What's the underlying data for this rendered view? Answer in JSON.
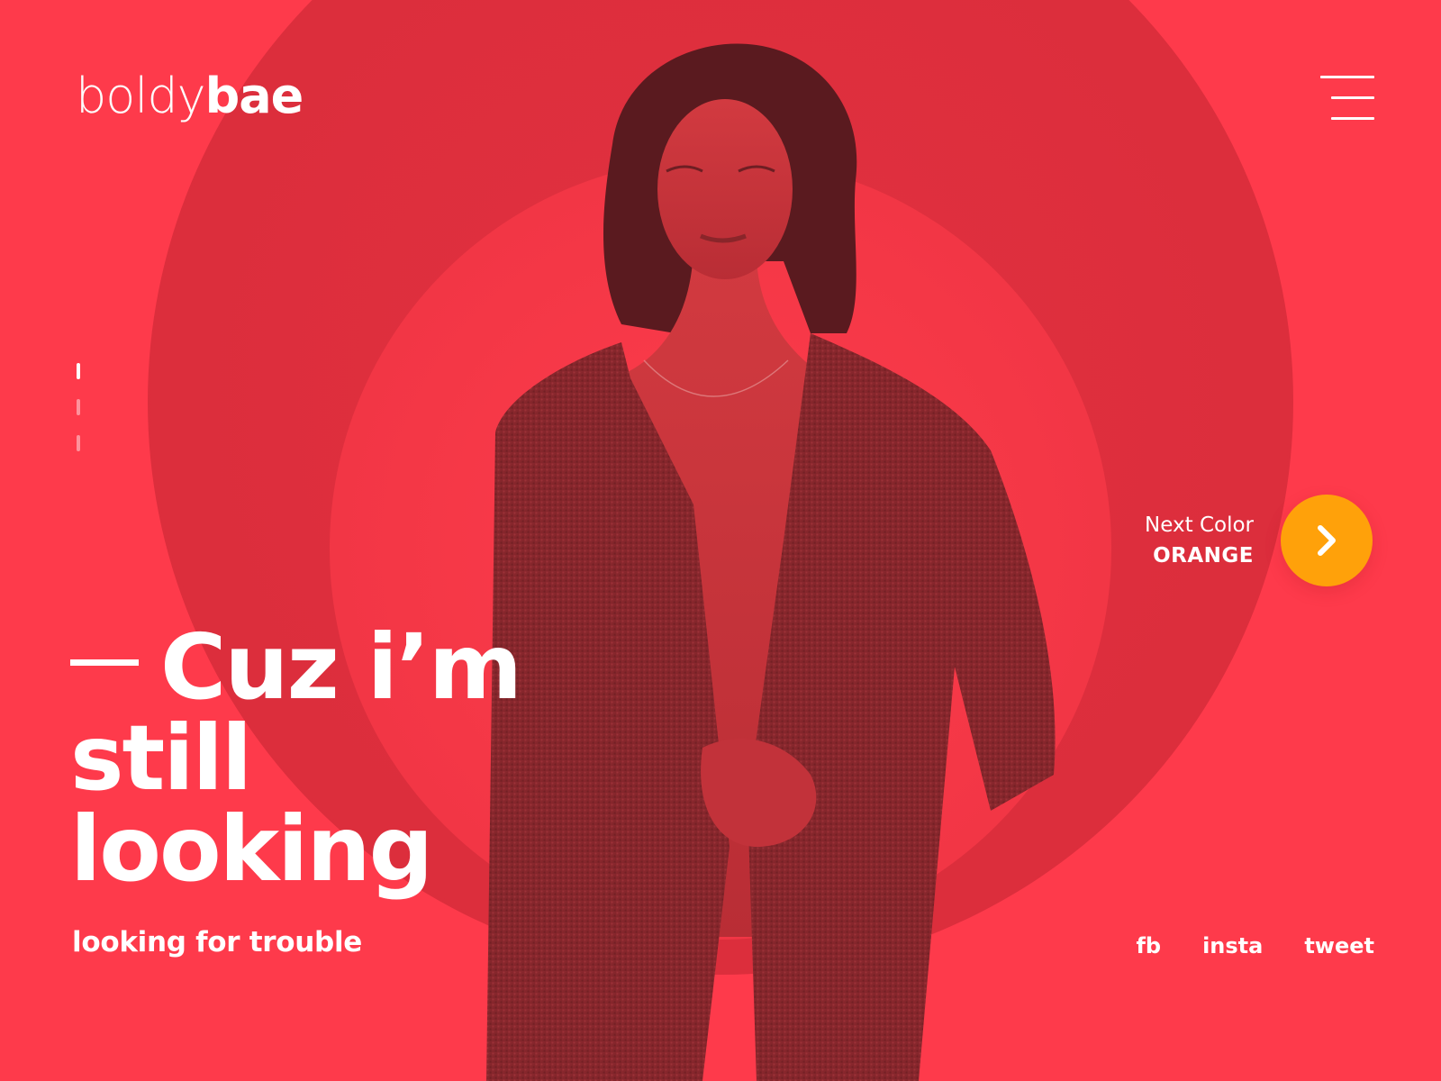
{
  "brand": {
    "logo_light": "boldy",
    "logo_bold": "bae"
  },
  "colors": {
    "background": "#fe3a4b",
    "accent_next": "#ffa10a",
    "text": "#ffffff"
  },
  "header": {
    "menu_icon": "hamburger-menu-icon"
  },
  "pager": {
    "slides": 3,
    "active_index": 0
  },
  "next_color": {
    "label": "Next Color",
    "value": "ORANGE",
    "icon": "chevron-right-icon"
  },
  "hero": {
    "headline_line1": "Cuz i’m",
    "headline_line2": "still",
    "headline_line3": "looking",
    "subheadline": "looking for trouble"
  },
  "social": {
    "fb": "fb",
    "insta": "insta",
    "tweet": "tweet"
  }
}
